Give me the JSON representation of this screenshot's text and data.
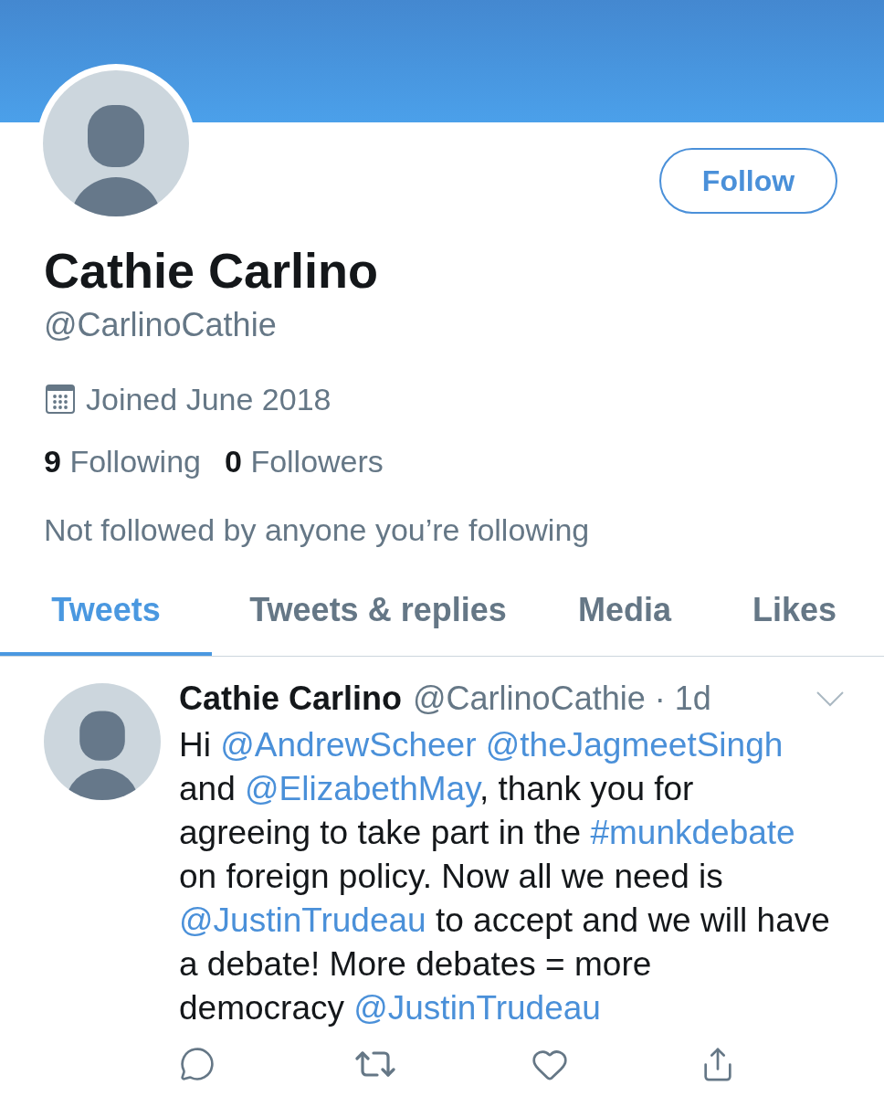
{
  "profile": {
    "name": "Cathie Carlino",
    "handle": "@CarlinoCathie",
    "follow_button": "Follow",
    "joined": "Joined June 2018",
    "stats": [
      {
        "count": "9",
        "label": "Following"
      },
      {
        "count": "0",
        "label": "Followers"
      }
    ],
    "followed_by": "Not followed by anyone you’re following"
  },
  "tabs": [
    {
      "label": "Tweets",
      "selected": true
    },
    {
      "label": "Tweets & replies",
      "selected": false
    },
    {
      "label": "Media",
      "selected": false
    },
    {
      "label": "Likes",
      "selected": false
    }
  ],
  "tweets": [
    {
      "author": "Cathie Carlino",
      "meta": "@CarlinoCathie · 1d",
      "lines": [
        [
          {
            "kind": "text",
            "text": "Hi "
          },
          {
            "kind": "mention",
            "text": "@AndrewScheer"
          },
          {
            "kind": "mention",
            "text": "@theJagmeetSingh"
          }
        ],
        [
          {
            "kind": "text",
            "text": "and "
          },
          {
            "kind": "mention",
            "text": "@ElizabethMay"
          },
          {
            "kind": "text",
            "text": ", thank you for"
          }
        ],
        [
          {
            "kind": "text",
            "text": "agreeing to take part in the "
          },
          {
            "kind": "hashtag",
            "text": "#munkdebate"
          }
        ],
        [
          {
            "kind": "text",
            "text": "on foreign policy. Now all we need is"
          }
        ],
        [
          {
            "kind": "mention",
            "text": "@JustinTrudeau"
          },
          {
            "kind": "text",
            "text": " to accept and we will have"
          }
        ],
        [
          {
            "kind": "text",
            "text": "a debate! More debates = more"
          }
        ],
        [
          {
            "kind": "text",
            "text": "democracy "
          },
          {
            "kind": "mention",
            "text": "@JustinTrudeau"
          }
        ]
      ]
    }
  ]
}
